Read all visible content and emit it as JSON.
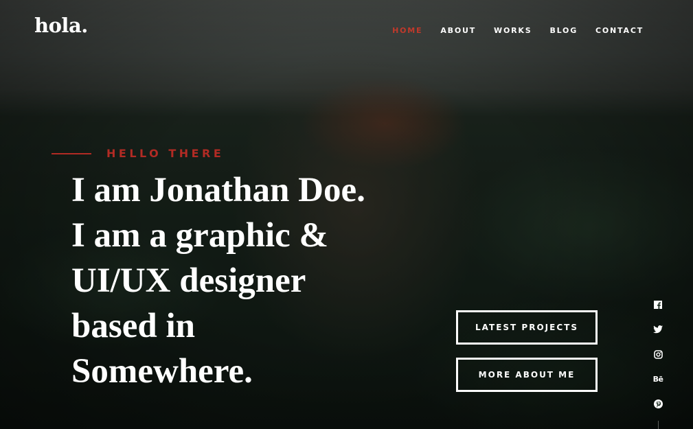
{
  "brand": {
    "logo_text": "hola."
  },
  "nav": {
    "items": [
      {
        "label": "HOME",
        "active": true
      },
      {
        "label": "ABOUT",
        "active": false
      },
      {
        "label": "WORKS",
        "active": false
      },
      {
        "label": "BLOG",
        "active": false
      },
      {
        "label": "CONTACT",
        "active": false
      }
    ]
  },
  "hero": {
    "pretitle": "HELLO THERE",
    "headline_lines": [
      "I am Jonathan Doe.",
      "I am a graphic &",
      "UI/UX designer",
      "based in",
      "Somewhere."
    ]
  },
  "buttons": {
    "latest_projects": "LATEST PROJECTS",
    "more_about_me": "MORE ABOUT ME"
  },
  "social": {
    "icons": [
      "facebook-icon",
      "twitter-icon",
      "instagram-icon",
      "behance-icon",
      "pinterest-icon"
    ],
    "behance_text": "Bē"
  },
  "colors": {
    "accent": "#b22b24",
    "nav_active": "#c0392b",
    "text": "#ffffff"
  }
}
